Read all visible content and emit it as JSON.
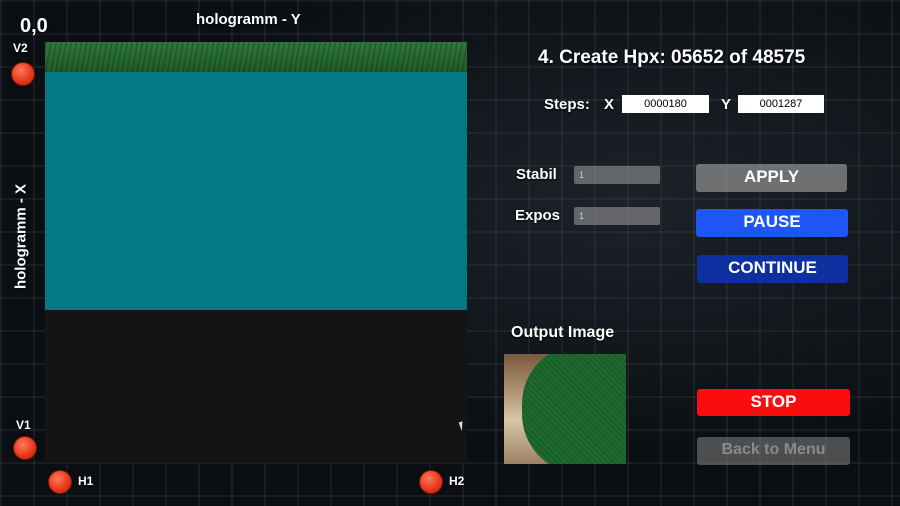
{
  "canvas": {
    "origin_label": "0,0",
    "title_y": "hologramm - Y",
    "title_x": "hologramm - X",
    "corners": {
      "v2": "V2",
      "v1": "V1",
      "h1": "H1",
      "h2": "H2"
    }
  },
  "status": {
    "text": "4. Create Hpx: 05652 of 48575"
  },
  "steps": {
    "label": "Steps:",
    "x_label": "X",
    "x_value": "0000180",
    "y_label": "Y",
    "y_value": "0001287"
  },
  "fields": {
    "stabil_label": "Stabil",
    "stabil_value": "1",
    "expos_label": "Expos",
    "expos_value": "1"
  },
  "buttons": {
    "apply": "APPLY",
    "pause": "PAUSE",
    "continue": "CONTINUE",
    "stop": "STOP",
    "back": "Back to Menu"
  },
  "output": {
    "label": "Output Image"
  },
  "colors": {
    "teal": "#037986",
    "grass": "#1e5a2a",
    "pause": "#1e55f5",
    "continue": "#0d2fa0",
    "stop": "#fb0d0d",
    "corner_dot": "#e8381c"
  }
}
